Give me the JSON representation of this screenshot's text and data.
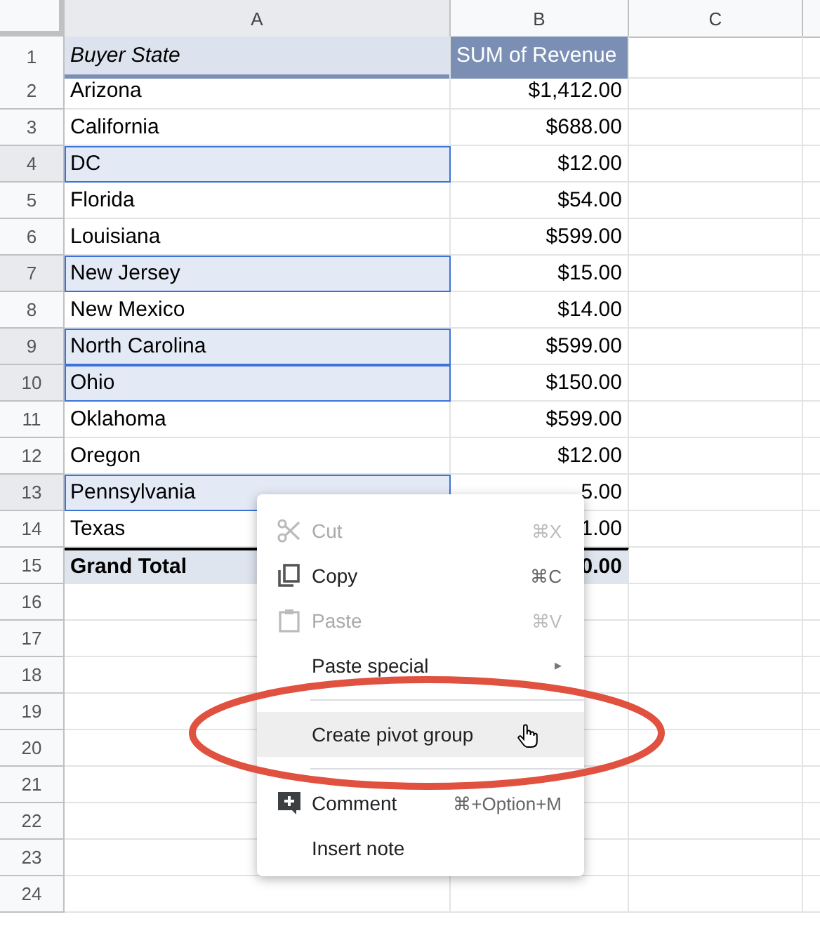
{
  "columns": [
    {
      "label": "A",
      "selected": true
    },
    {
      "label": "B",
      "selected": false
    },
    {
      "label": "C",
      "selected": false
    }
  ],
  "rows": [
    {
      "number": "1",
      "kind": "header",
      "label": "Buyer State",
      "value": "SUM of Revenue",
      "selected": false
    },
    {
      "number": "2",
      "kind": "data",
      "label": "Arizona",
      "value": "$1,412.00",
      "selected": false
    },
    {
      "number": "3",
      "kind": "data",
      "label": "California",
      "value": "$688.00",
      "selected": false
    },
    {
      "number": "4",
      "kind": "data",
      "label": "DC",
      "value": "$12.00",
      "selected": true
    },
    {
      "number": "5",
      "kind": "data",
      "label": "Florida",
      "value": "$54.00",
      "selected": false
    },
    {
      "number": "6",
      "kind": "data",
      "label": "Louisiana",
      "value": "$599.00",
      "selected": false
    },
    {
      "number": "7",
      "kind": "data",
      "label": "New Jersey",
      "value": "$15.00",
      "selected": true
    },
    {
      "number": "8",
      "kind": "data",
      "label": "New Mexico",
      "value": "$14.00",
      "selected": false
    },
    {
      "number": "9",
      "kind": "data",
      "label": "North Carolina",
      "value": "$599.00",
      "selected": true
    },
    {
      "number": "10",
      "kind": "data",
      "label": "Ohio",
      "value": "$150.00",
      "selected": true
    },
    {
      "number": "11",
      "kind": "data",
      "label": "Oklahoma",
      "value": "$599.00",
      "selected": false
    },
    {
      "number": "12",
      "kind": "data",
      "label": "Oregon",
      "value": "$12.00",
      "selected": false
    },
    {
      "number": "13",
      "kind": "data",
      "label": "Pennsylvania",
      "value": "5.00",
      "selected": true
    },
    {
      "number": "14",
      "kind": "data",
      "label": "Texas",
      "value": "1.00",
      "selected": false
    },
    {
      "number": "15",
      "kind": "total",
      "label": "Grand Total",
      "value": "0.00",
      "selected": false
    },
    {
      "number": "16",
      "kind": "empty",
      "selected": false
    },
    {
      "number": "17",
      "kind": "empty",
      "selected": false
    },
    {
      "number": "18",
      "kind": "empty",
      "selected": false
    },
    {
      "number": "19",
      "kind": "empty",
      "selected": false
    },
    {
      "number": "20",
      "kind": "empty",
      "selected": false
    },
    {
      "number": "21",
      "kind": "empty",
      "selected": false
    },
    {
      "number": "22",
      "kind": "empty",
      "selected": false
    },
    {
      "number": "23",
      "kind": "empty",
      "selected": false
    },
    {
      "number": "24",
      "kind": "empty",
      "selected": false
    }
  ],
  "context_menu": {
    "items": [
      {
        "kind": "cut",
        "label": "Cut",
        "shortcut": "⌘X",
        "disabled": true,
        "hovered": false
      },
      {
        "kind": "copy",
        "label": "Copy",
        "shortcut": "⌘C",
        "disabled": false,
        "hovered": false
      },
      {
        "kind": "paste",
        "label": "Paste",
        "shortcut": "⌘V",
        "disabled": true,
        "hovered": false
      },
      {
        "kind": "submenu",
        "label": "Paste special",
        "shortcut": "▸",
        "disabled": false,
        "hovered": false
      },
      {
        "kind": "divider"
      },
      {
        "kind": "item",
        "label": "Create pivot group",
        "disabled": false,
        "hovered": true
      },
      {
        "kind": "divider"
      },
      {
        "kind": "comment",
        "label": "Comment",
        "shortcut": "⌘+Option+M",
        "disabled": false,
        "hovered": false
      },
      {
        "kind": "item",
        "label": "Insert note",
        "disabled": false,
        "hovered": false
      }
    ]
  },
  "annotation": {
    "kind": "ellipse",
    "color": "#e0513f"
  }
}
